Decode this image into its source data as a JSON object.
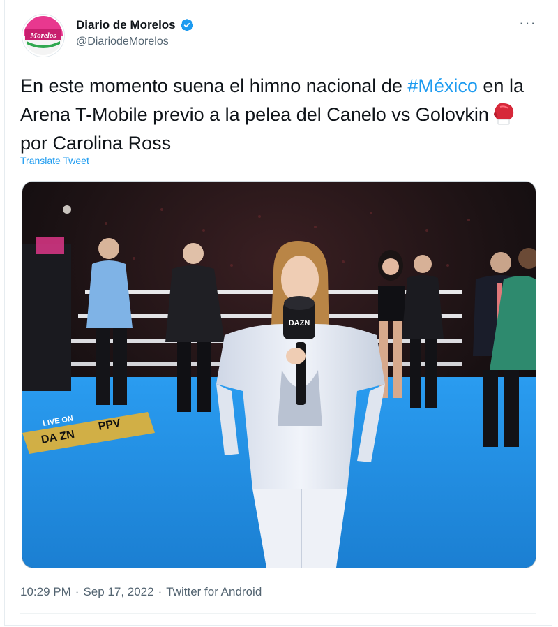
{
  "tweet": {
    "display_name": "Diario de Morelos",
    "handle": "@DiariodeMorelos",
    "avatar_logo_text": "Morelos",
    "more_label": "···",
    "text_part1": "En este momento suena el himno nacional de ",
    "hashtag": "#México",
    "text_part2": " en la Arena T-Mobile previo a la pelea del Canelo vs Golovkin",
    "text_part3": "por Carolina Ross",
    "emoji_icon": "boxing-glove-icon",
    "translate_label": "Translate Tweet",
    "time": "10:29 PM",
    "separator": "·",
    "date": "Sep 17, 2022",
    "source": "Twitter for Android"
  },
  "media": {
    "banner_live": "LIVE ON",
    "banner_dazn": "DA ZN",
    "banner_ppv": "PPV",
    "mic_label": "DAZN"
  },
  "colors": {
    "accent": "#1d9bf0",
    "text": "#0f1419",
    "muted": "#536471",
    "canvas_blue": "#1f8ee0"
  }
}
